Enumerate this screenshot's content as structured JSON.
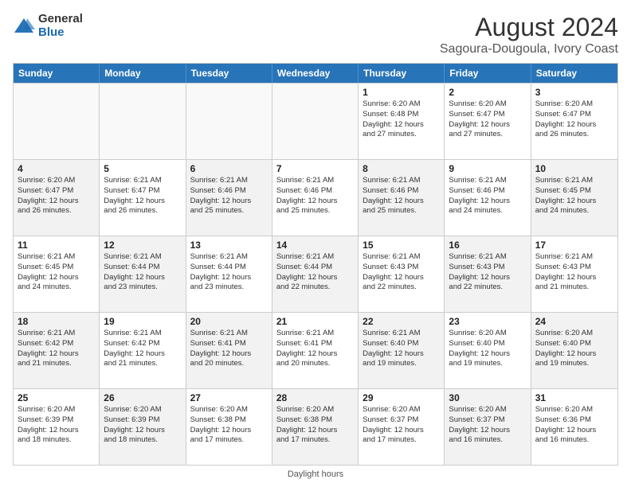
{
  "logo": {
    "general": "General",
    "blue": "Blue"
  },
  "title": "August 2024",
  "location": "Sagoura-Dougoula, Ivory Coast",
  "headers": [
    "Sunday",
    "Monday",
    "Tuesday",
    "Wednesday",
    "Thursday",
    "Friday",
    "Saturday"
  ],
  "footer": "Daylight hours",
  "rows": [
    [
      {
        "day": "",
        "info": "",
        "empty": true
      },
      {
        "day": "",
        "info": "",
        "empty": true
      },
      {
        "day": "",
        "info": "",
        "empty": true
      },
      {
        "day": "",
        "info": "",
        "empty": true
      },
      {
        "day": "1",
        "info": "Sunrise: 6:20 AM\nSunset: 6:48 PM\nDaylight: 12 hours\nand 27 minutes."
      },
      {
        "day": "2",
        "info": "Sunrise: 6:20 AM\nSunset: 6:47 PM\nDaylight: 12 hours\nand 27 minutes."
      },
      {
        "day": "3",
        "info": "Sunrise: 6:20 AM\nSunset: 6:47 PM\nDaylight: 12 hours\nand 26 minutes."
      }
    ],
    [
      {
        "day": "4",
        "info": "Sunrise: 6:20 AM\nSunset: 6:47 PM\nDaylight: 12 hours\nand 26 minutes.",
        "shaded": true
      },
      {
        "day": "5",
        "info": "Sunrise: 6:21 AM\nSunset: 6:47 PM\nDaylight: 12 hours\nand 26 minutes."
      },
      {
        "day": "6",
        "info": "Sunrise: 6:21 AM\nSunset: 6:46 PM\nDaylight: 12 hours\nand 25 minutes.",
        "shaded": true
      },
      {
        "day": "7",
        "info": "Sunrise: 6:21 AM\nSunset: 6:46 PM\nDaylight: 12 hours\nand 25 minutes."
      },
      {
        "day": "8",
        "info": "Sunrise: 6:21 AM\nSunset: 6:46 PM\nDaylight: 12 hours\nand 25 minutes.",
        "shaded": true
      },
      {
        "day": "9",
        "info": "Sunrise: 6:21 AM\nSunset: 6:46 PM\nDaylight: 12 hours\nand 24 minutes."
      },
      {
        "day": "10",
        "info": "Sunrise: 6:21 AM\nSunset: 6:45 PM\nDaylight: 12 hours\nand 24 minutes.",
        "shaded": true
      }
    ],
    [
      {
        "day": "11",
        "info": "Sunrise: 6:21 AM\nSunset: 6:45 PM\nDaylight: 12 hours\nand 24 minutes."
      },
      {
        "day": "12",
        "info": "Sunrise: 6:21 AM\nSunset: 6:44 PM\nDaylight: 12 hours\nand 23 minutes.",
        "shaded": true
      },
      {
        "day": "13",
        "info": "Sunrise: 6:21 AM\nSunset: 6:44 PM\nDaylight: 12 hours\nand 23 minutes."
      },
      {
        "day": "14",
        "info": "Sunrise: 6:21 AM\nSunset: 6:44 PM\nDaylight: 12 hours\nand 22 minutes.",
        "shaded": true
      },
      {
        "day": "15",
        "info": "Sunrise: 6:21 AM\nSunset: 6:43 PM\nDaylight: 12 hours\nand 22 minutes."
      },
      {
        "day": "16",
        "info": "Sunrise: 6:21 AM\nSunset: 6:43 PM\nDaylight: 12 hours\nand 22 minutes.",
        "shaded": true
      },
      {
        "day": "17",
        "info": "Sunrise: 6:21 AM\nSunset: 6:43 PM\nDaylight: 12 hours\nand 21 minutes."
      }
    ],
    [
      {
        "day": "18",
        "info": "Sunrise: 6:21 AM\nSunset: 6:42 PM\nDaylight: 12 hours\nand 21 minutes.",
        "shaded": true
      },
      {
        "day": "19",
        "info": "Sunrise: 6:21 AM\nSunset: 6:42 PM\nDaylight: 12 hours\nand 21 minutes."
      },
      {
        "day": "20",
        "info": "Sunrise: 6:21 AM\nSunset: 6:41 PM\nDaylight: 12 hours\nand 20 minutes.",
        "shaded": true
      },
      {
        "day": "21",
        "info": "Sunrise: 6:21 AM\nSunset: 6:41 PM\nDaylight: 12 hours\nand 20 minutes."
      },
      {
        "day": "22",
        "info": "Sunrise: 6:21 AM\nSunset: 6:40 PM\nDaylight: 12 hours\nand 19 minutes.",
        "shaded": true
      },
      {
        "day": "23",
        "info": "Sunrise: 6:20 AM\nSunset: 6:40 PM\nDaylight: 12 hours\nand 19 minutes."
      },
      {
        "day": "24",
        "info": "Sunrise: 6:20 AM\nSunset: 6:40 PM\nDaylight: 12 hours\nand 19 minutes.",
        "shaded": true
      }
    ],
    [
      {
        "day": "25",
        "info": "Sunrise: 6:20 AM\nSunset: 6:39 PM\nDaylight: 12 hours\nand 18 minutes."
      },
      {
        "day": "26",
        "info": "Sunrise: 6:20 AM\nSunset: 6:39 PM\nDaylight: 12 hours\nand 18 minutes.",
        "shaded": true
      },
      {
        "day": "27",
        "info": "Sunrise: 6:20 AM\nSunset: 6:38 PM\nDaylight: 12 hours\nand 17 minutes."
      },
      {
        "day": "28",
        "info": "Sunrise: 6:20 AM\nSunset: 6:38 PM\nDaylight: 12 hours\nand 17 minutes.",
        "shaded": true
      },
      {
        "day": "29",
        "info": "Sunrise: 6:20 AM\nSunset: 6:37 PM\nDaylight: 12 hours\nand 17 minutes."
      },
      {
        "day": "30",
        "info": "Sunrise: 6:20 AM\nSunset: 6:37 PM\nDaylight: 12 hours\nand 16 minutes.",
        "shaded": true
      },
      {
        "day": "31",
        "info": "Sunrise: 6:20 AM\nSunset: 6:36 PM\nDaylight: 12 hours\nand 16 minutes."
      }
    ]
  ]
}
